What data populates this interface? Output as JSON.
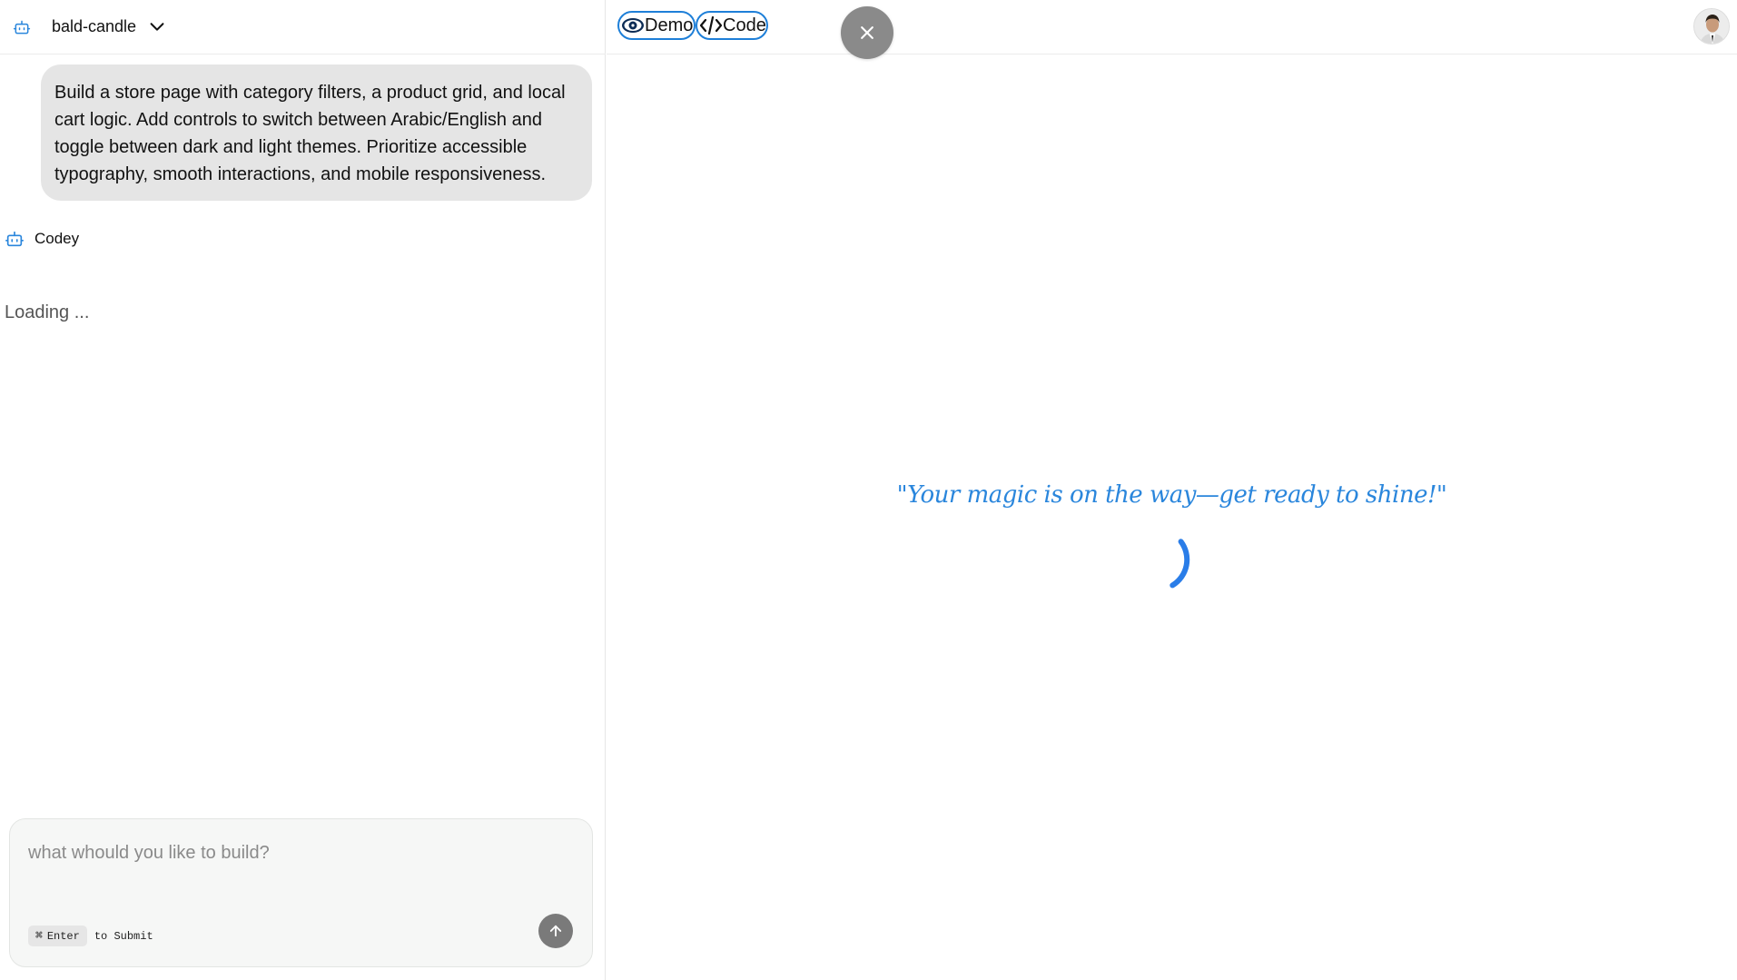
{
  "left_header": {
    "project_name": "bald-candle",
    "project_icon": "robot-icon",
    "dropdown_icon": "chevron-down-icon"
  },
  "chat": {
    "user_message": "Build a store page with category filters, a product grid, and local cart logic. Add controls to switch between Arabic/English and toggle between dark and light themes. Prioritize accessible typography, smooth interactions, and mobile responsiveness.",
    "assistant_name": "Codey",
    "assistant_icon": "robot-icon",
    "loading_text": "Loading ..."
  },
  "composer": {
    "placeholder": "what whould you like to build?",
    "shortcut_key": "Enter",
    "shortcut_modifier": "⌘",
    "shortcut_suffix": "to Submit",
    "send_icon": "arrow-up-icon"
  },
  "right_header": {
    "tabs": [
      {
        "label": "Demo",
        "icon": "eye-icon"
      },
      {
        "label": "Code",
        "icon": "code-icon"
      }
    ],
    "close_icon": "close-icon",
    "avatar_icon": "avatar"
  },
  "preview": {
    "message": "\"Your magic is on the way—get ready to shine!\"",
    "spinner_icon": "spinner-icon"
  },
  "colors": {
    "accent": "#1e7fd8",
    "spinner": "#2a7de8",
    "bubble": "#e5e5e5",
    "send_button": "#7a7a7a"
  }
}
